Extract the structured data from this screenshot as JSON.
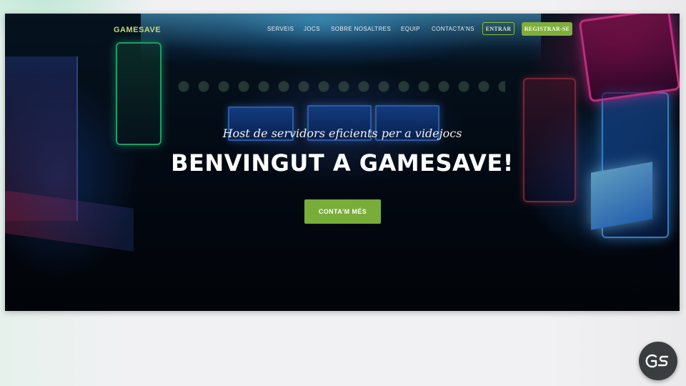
{
  "navbar": {
    "brand": "GAMESAVE",
    "links": [
      "SERVEIS",
      "JOCS",
      "SOBRE NOSALTRES",
      "EQUIP",
      "CONTACTA'NS"
    ],
    "login_label": "ENTRAR",
    "register_label": "REGISTRAR-SE"
  },
  "hero": {
    "subtitle": "Host de servidors eficients per a videjocs",
    "title": "BENVINGUT A GAMESAVE!",
    "cta_label": "CONTA'M MÉS"
  },
  "slide": {
    "logo_text": "GS"
  },
  "colors": {
    "accent_green": "#78ad3a",
    "brand_text": "#c5d97a",
    "logo_bg": "#3a3d40"
  },
  "icons": {
    "slide_logo": "gamesave-logo"
  }
}
